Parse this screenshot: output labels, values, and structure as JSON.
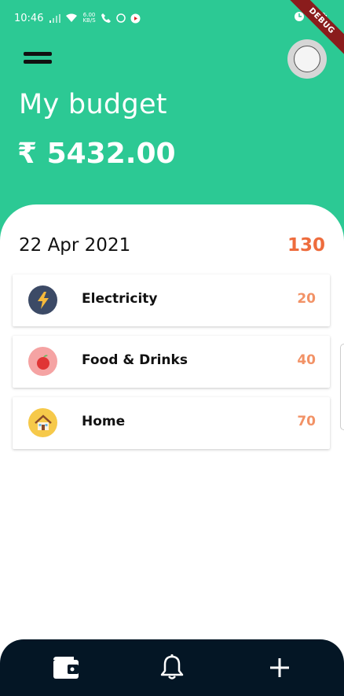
{
  "status_bar": {
    "time": "10:46",
    "net_speed_value": "6.00",
    "net_speed_unit": "KB/S"
  },
  "debug_banner": "DEBUG",
  "header": {
    "title": "My budget",
    "amount": "₹ 5432.00"
  },
  "summary": {
    "date": "22 Apr 2021",
    "total": "130"
  },
  "categories": [
    {
      "name": "Electricity",
      "amount": "20",
      "icon": "lightning-icon",
      "icon_bg": "#3c4a66"
    },
    {
      "name": "Food & Drinks",
      "amount": "40",
      "icon": "apple-icon",
      "icon_bg": "#f5a3a3"
    },
    {
      "name": "Home",
      "amount": "70",
      "icon": "house-icon",
      "icon_bg": "#f6c94a"
    }
  ],
  "bottom_nav": {
    "items": [
      "wallet-icon",
      "bell-icon",
      "plus-icon"
    ]
  },
  "colors": {
    "accent": "#2cc994",
    "total_color": "#ee6c3d",
    "amount_color": "#f29266",
    "nav_bg": "#041625"
  }
}
